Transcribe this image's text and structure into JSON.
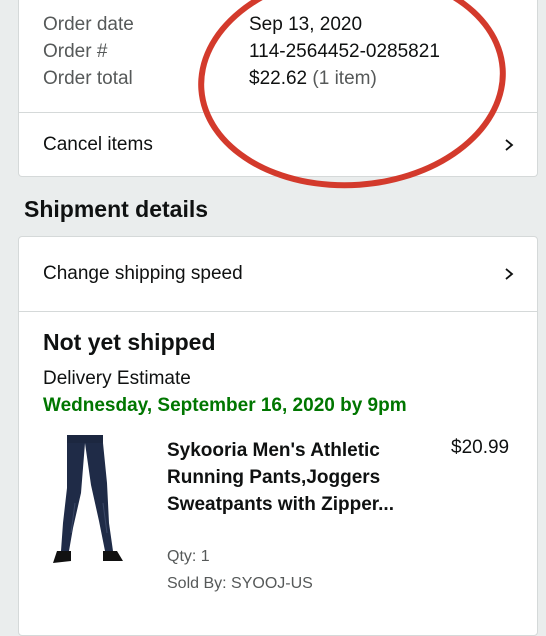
{
  "order": {
    "date_label": "Order date",
    "date_value": "Sep 13, 2020",
    "number_label": "Order #",
    "number_value": "114-2564452-0285821",
    "total_label": "Order total",
    "total_value": "$22.62",
    "total_items": "(1 item)",
    "cancel_label": "Cancel items"
  },
  "shipment": {
    "section_title": "Shipment details",
    "change_speed_label": "Change shipping speed",
    "status": "Not yet shipped",
    "delivery_label": "Delivery Estimate",
    "delivery_date": "Wednesday, September 16, 2020 by 9pm",
    "delivery_color": "#007600",
    "item": {
      "title": "Sykooria Men's Athletic Running Pants,Joggers Sweatpants with Zipper...",
      "price": "$20.99",
      "qty": "Qty: 1",
      "seller": "Sold By: SYOOJ-US"
    }
  },
  "annotation_color": "#d33a2c"
}
